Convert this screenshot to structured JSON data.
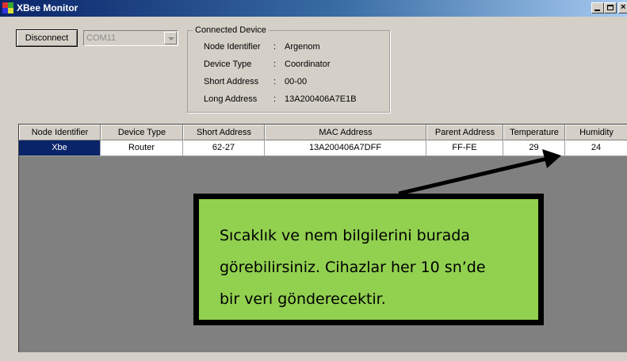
{
  "window": {
    "title": "XBee Monitor",
    "close_glyph": "×"
  },
  "controls": {
    "disconnect_label": "Disconnect",
    "port_value": "COM11"
  },
  "connected_device": {
    "legend": "Connected Device",
    "rows": [
      {
        "label": "Node Identifier",
        "value": "Argenom"
      },
      {
        "label": "Device Type",
        "value": "Coordinator"
      },
      {
        "label": "Short Address",
        "value": "00-00"
      },
      {
        "label": "Long Address",
        "value": "13A200406A7E1B"
      }
    ],
    "separator": ":"
  },
  "grid": {
    "columns": [
      "Node Identifier",
      "Device Type",
      "Short Address",
      "MAC Address",
      "Parent Address",
      "Temperature",
      "Humidity"
    ],
    "rows": [
      [
        "Xbe",
        "Router",
        "62-27",
        "13A200406A7DFF",
        "FF-FE",
        "29",
        "24"
      ]
    ]
  },
  "callout": {
    "lines": [
      "Sıcaklık ve nem bilgilerini burada",
      "görebilirsiniz. Cihazlar her 10 sn’de",
      "bir veri gönderecektir."
    ]
  },
  "colors": {
    "titlebar_start": "#0a246a",
    "selection": "#0a246a",
    "callout_fill": "#92d050",
    "grid_background": "#808080"
  },
  "icons": [
    "app-icon",
    "minimize-icon",
    "maximize-icon",
    "close-icon",
    "chevron-down-icon"
  ]
}
